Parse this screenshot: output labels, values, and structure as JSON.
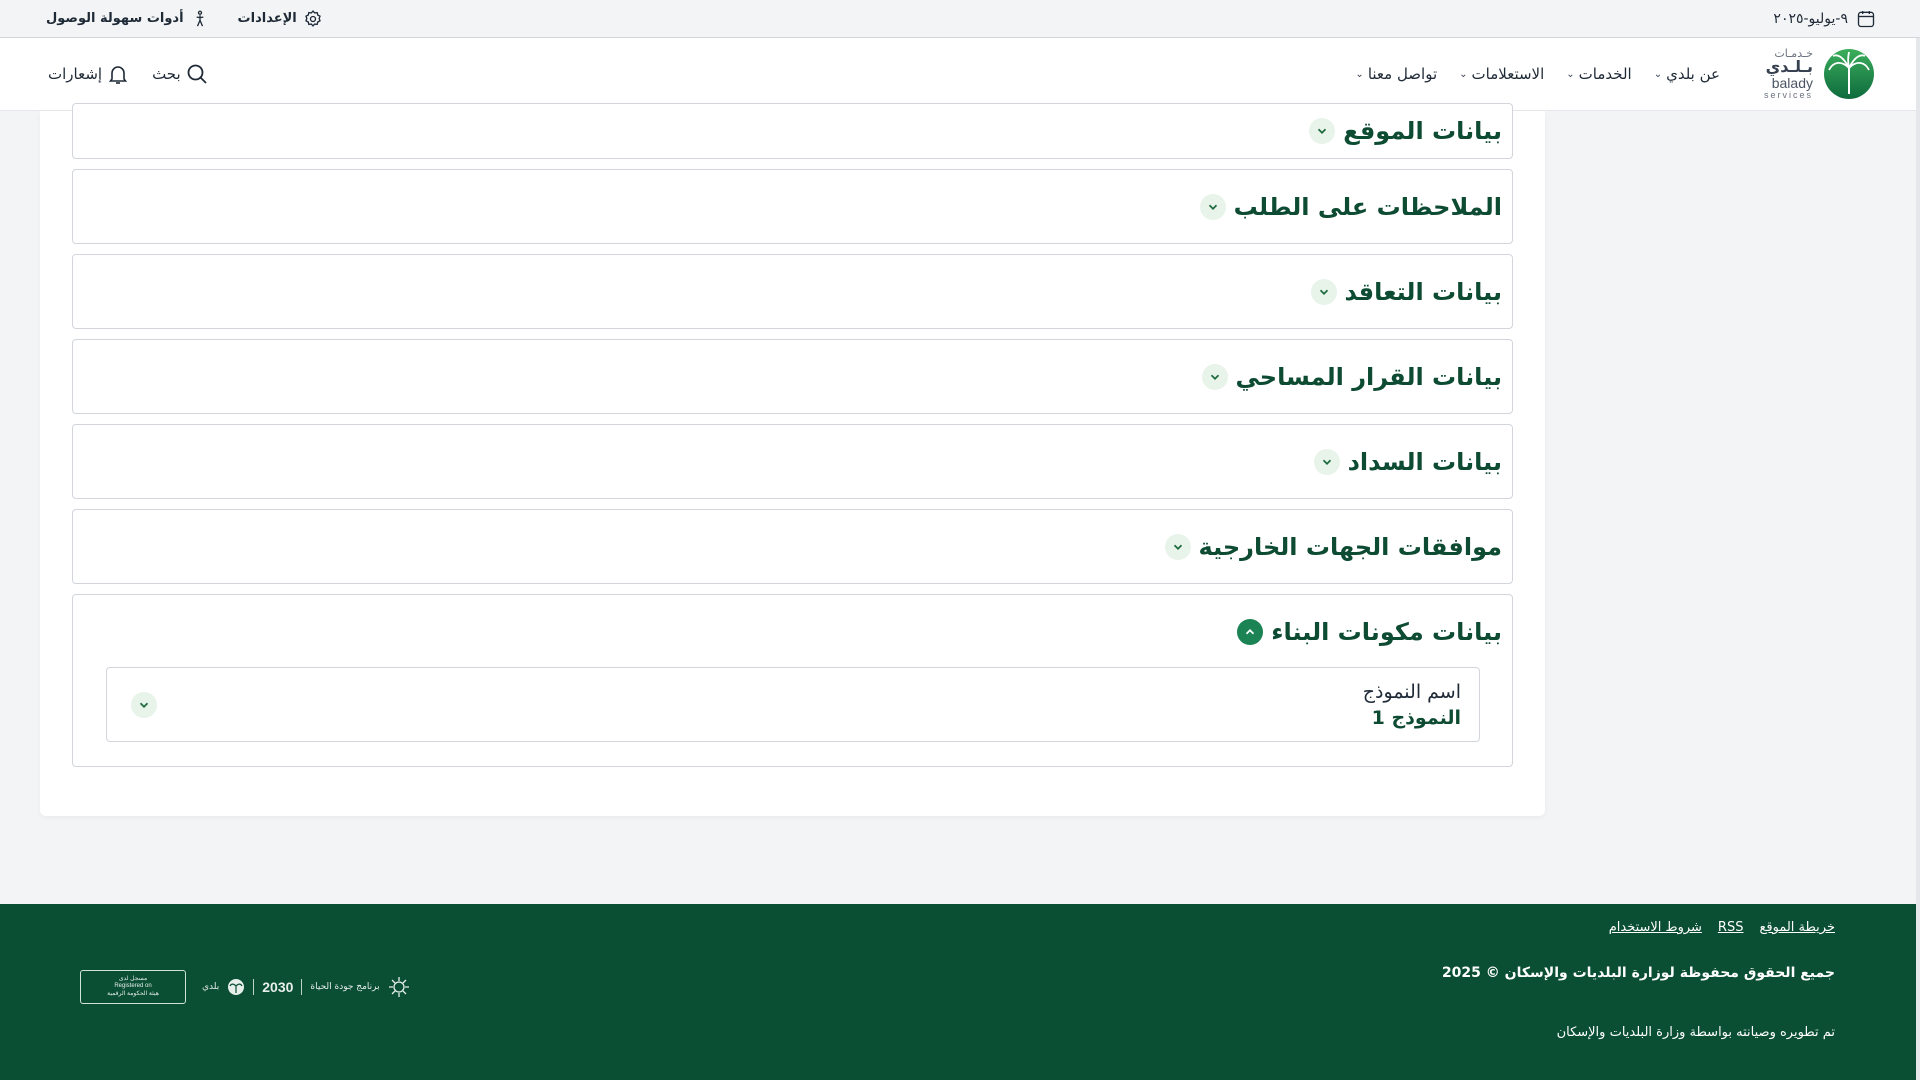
{
  "topbar": {
    "date": "٩-يوليو-٢٠٢٥",
    "settings_label": "الإعدادات",
    "accessibility_label": "أدوات سهولة الوصول"
  },
  "nav": {
    "logo": {
      "ar_small": "خـدمـات",
      "ar_big": "بـلـدي",
      "en": "balady",
      "en_sub": "services"
    },
    "links": [
      {
        "label": "عن بلدي",
        "has_dropdown": true
      },
      {
        "label": "الخدمات",
        "has_dropdown": true
      },
      {
        "label": "الاستعلامات",
        "has_dropdown": true
      },
      {
        "label": "تواصل معنا",
        "has_dropdown": true
      }
    ],
    "search_label": "بحث",
    "notifications_label": "إشعارات"
  },
  "accordions": [
    {
      "title": "بيانات الموقع",
      "expanded": false
    },
    {
      "title": "الملاحظات على الطلب",
      "expanded": false
    },
    {
      "title": "بيانات التعاقد",
      "expanded": false
    },
    {
      "title": "بيانات القرار المساحي",
      "expanded": false
    },
    {
      "title": "بيانات السداد",
      "expanded": false
    },
    {
      "title": "موافقات الجهات الخارجية",
      "expanded": false
    },
    {
      "title": "بيانات مكونات البناء",
      "expanded": true
    }
  ],
  "building_components": {
    "model_label": "اسم النموذج",
    "model_value": "النموذج 1"
  },
  "footer": {
    "links": [
      "خريطة الموقع",
      "RSS",
      "شروط الاستخدام"
    ],
    "copyright": "جميع الحقوق محفوظة لوزارة البلديات والإسكان © 2025",
    "developed_by": "تم تطويره وصيانته بواسطة وزارة البلديات والإسكان",
    "logos": {
      "vision_program": "برنامج جودة الحياة",
      "vision_year": "2030",
      "balady": "بلدي",
      "dga_top": "مسجل لدى",
      "dga_en": "Registered on",
      "dga_name": "هيئة الحكومة الرقمية"
    }
  },
  "colors": {
    "primary_green": "#1b8354",
    "dark_green": "#0e4b33",
    "footer_green": "#0a4e34",
    "light_green": "#e8f3ea"
  }
}
